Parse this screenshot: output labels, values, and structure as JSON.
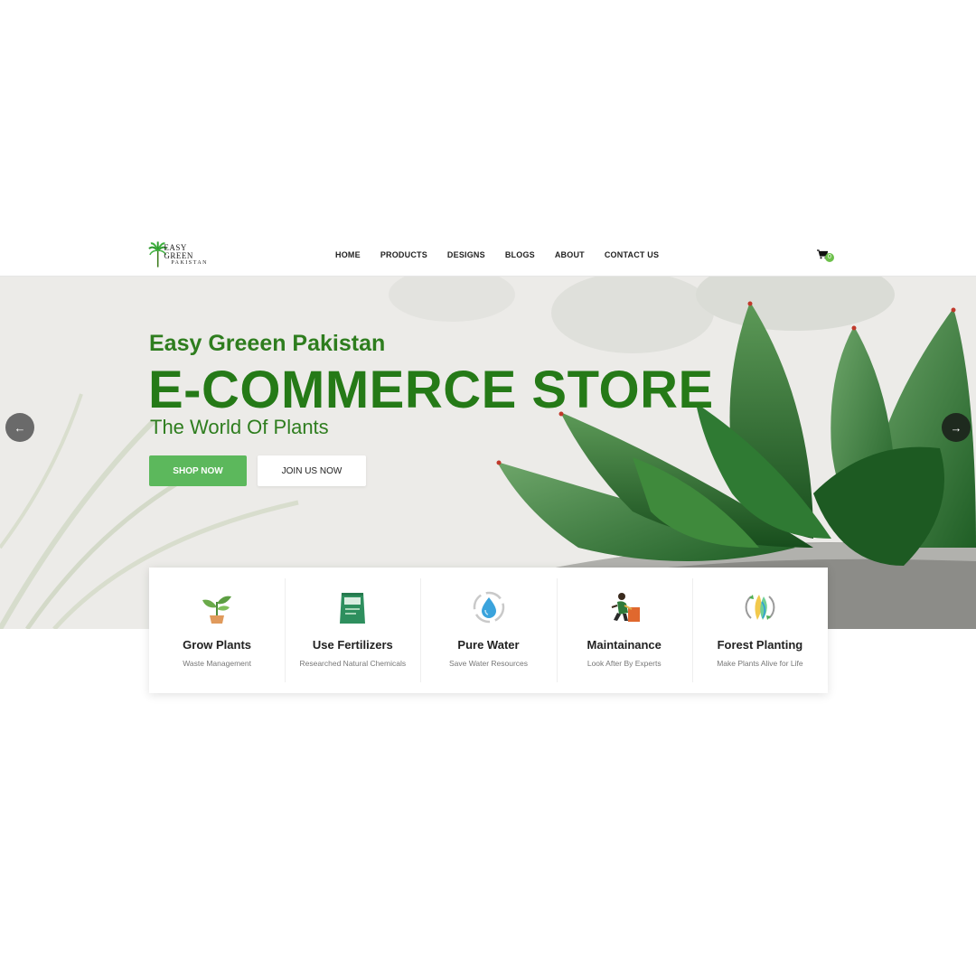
{
  "header": {
    "logo": {
      "line1": "EASY GREEN",
      "line2": "PAKISTAN"
    },
    "nav": [
      "HOME",
      "PRODUCTS",
      "DESIGNS",
      "BLOGS",
      "ABOUT",
      "CONTACT US"
    ],
    "cart_count": "0"
  },
  "hero": {
    "title_small": "Easy Greeen Pakistan",
    "title_big": "E-COMMERCE STORE",
    "subtitle": "The World Of Plants",
    "shop_button": "SHOP NOW",
    "join_button": "JOIN US NOW",
    "prev_arrow": "←",
    "next_arrow": "→"
  },
  "features": [
    {
      "title": "Grow Plants",
      "desc": "Waste Management",
      "icon": "potted-plant-icon"
    },
    {
      "title": "Use Fertilizers",
      "desc": "Researched Natural Chemicals",
      "icon": "fertilizer-bag-icon"
    },
    {
      "title": "Pure Water",
      "desc": "Save Water Resources",
      "icon": "water-drop-icon"
    },
    {
      "title": "Maintainance",
      "desc": "Look After By Experts",
      "icon": "gardener-icon"
    },
    {
      "title": "Forest Planting",
      "desc": "Make Plants Alive for Life",
      "icon": "leaves-cycle-icon"
    }
  ],
  "colors": {
    "brand_green": "#257a17",
    "button_green": "#5cb85c",
    "badge_green": "#6cc04a"
  }
}
